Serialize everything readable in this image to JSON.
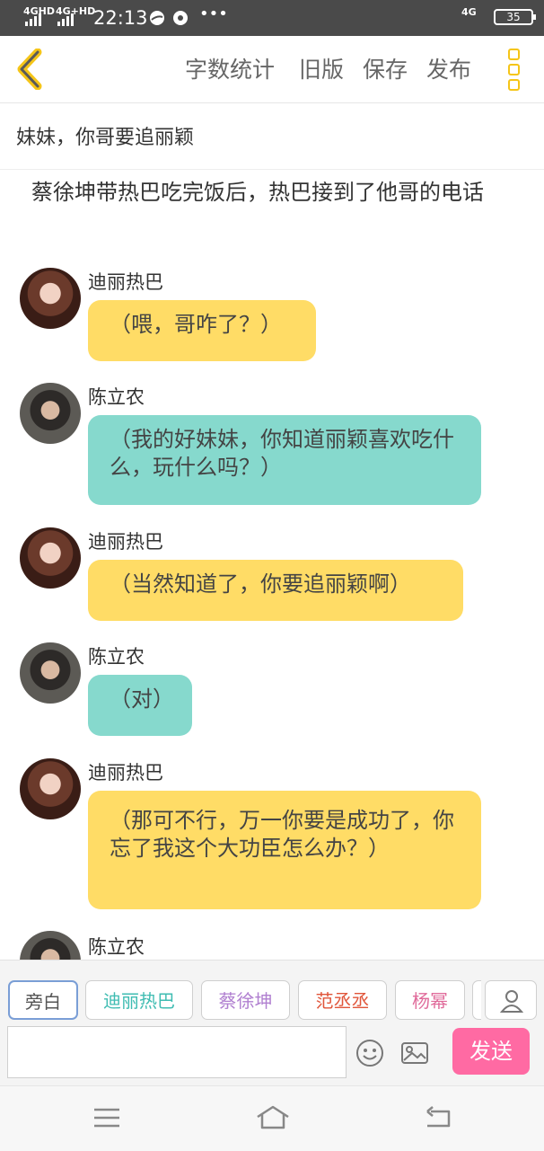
{
  "status_bar": {
    "signal_1": "4GHD",
    "signal_2": "4G+HD",
    "time": "22:13",
    "network": "4G",
    "battery": "35"
  },
  "toolbar": {
    "word_count_label": "字数统计",
    "old_version_label": "旧版",
    "save_label": "保存",
    "publish_label": "发布"
  },
  "story": {
    "title": "妹妹，你哥要追丽颖",
    "narration": "蔡徐坤带热巴吃完饭后，热巴接到了他哥的电话"
  },
  "messages": [
    {
      "speaker": "迪丽热巴",
      "text": "（喂，哥咋了？）",
      "color": "#ffdc66"
    },
    {
      "speaker": "陈立农",
      "text": "（我的好妹妹，你知道丽颖喜欢吃什么，玩什么吗？）",
      "color": "#86d9cd"
    },
    {
      "speaker": "迪丽热巴",
      "text": "（当然知道了，你要追丽颖啊）",
      "color": "#ffdc66"
    },
    {
      "speaker": "陈立农",
      "text": "（对）",
      "color": "#86d9cd"
    },
    {
      "speaker": "迪丽热巴",
      "text": "（那可不行，万一你要是成功了，你忘了我这个大功臣怎么办？）",
      "color": "#ffdc66"
    },
    {
      "speaker": "陈立农",
      "text": "",
      "color": "#86d9cd"
    }
  ],
  "role_chips": [
    {
      "label": "旁白",
      "color": "#555555",
      "selected": true
    },
    {
      "label": "迪丽热巴",
      "color": "#3fbcb2",
      "selected": false
    },
    {
      "label": "蔡徐坤",
      "color": "#b07fd0",
      "selected": false
    },
    {
      "label": "范丞丞",
      "color": "#e0553a",
      "selected": false
    },
    {
      "label": "杨幂",
      "color": "#e06a9a",
      "selected": false
    }
  ],
  "composer": {
    "input_value": "",
    "send_label": "发送"
  },
  "colors": {
    "accent_yellow": "#f5c518",
    "send_pink": "#ff6aa3"
  }
}
